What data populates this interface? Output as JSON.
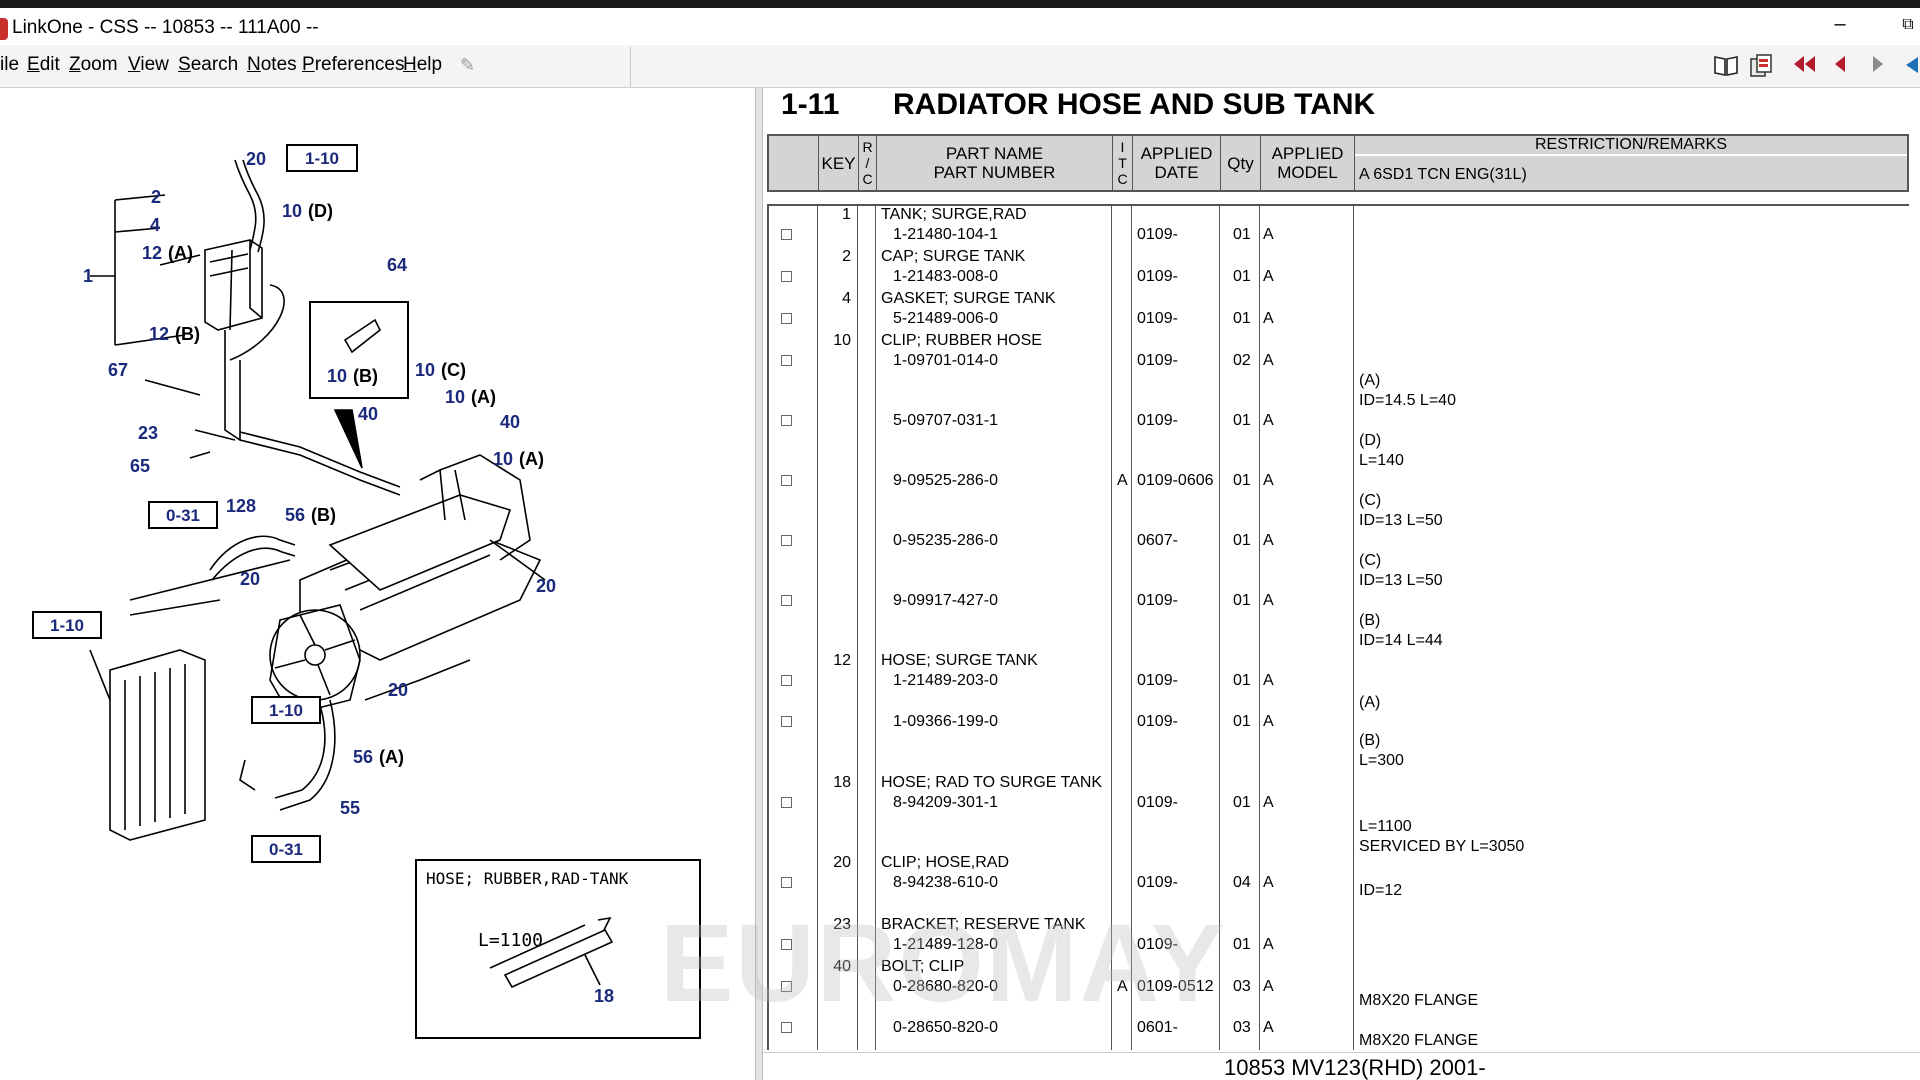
{
  "window": {
    "title": "LinkOne - CSS -- 10853 -- 111A00 --",
    "minimize": "–",
    "restore": "⧉"
  },
  "menu": [
    {
      "pre": "",
      "ul": "",
      "post": "ile"
    },
    {
      "pre": "",
      "ul": "E",
      "post": "dit"
    },
    {
      "pre": "",
      "ul": "Z",
      "post": "oom"
    },
    {
      "pre": "",
      "ul": "V",
      "post": "iew"
    },
    {
      "pre": "",
      "ul": "S",
      "post": "earch"
    },
    {
      "pre": "",
      "ul": "N",
      "post": "otes"
    },
    {
      "pre": "",
      "ul": "P",
      "post": "references"
    },
    {
      "pre": "",
      "ul": "H",
      "post": "elp"
    }
  ],
  "toolbar_icons": [
    "pin-icon",
    "book-icon",
    "notes-icon",
    "first-page-icon",
    "prev-page-icon",
    "next-page-icon",
    "back-icon"
  ],
  "section": {
    "number": "1-11",
    "title": "RADIATOR HOSE AND SUB TANK"
  },
  "columns": {
    "key": "KEY",
    "rc": [
      "R",
      "/",
      "C"
    ],
    "part_name": "PART NAME",
    "part_number": "PART NUMBER",
    "itc": [
      "I",
      "T",
      "C"
    ],
    "applied_date": [
      "APPLIED",
      "DATE"
    ],
    "qty": "Qty",
    "applied_model": [
      "APPLIED",
      "MODEL"
    ],
    "remarks": "RESTRICTION/REMARKS",
    "model_line": "A 6SD1 TCN ENG(31L)"
  },
  "rows": [
    {
      "key": "1",
      "name": "TANK; SURGE,RAD",
      "number": "1-21480-104-1",
      "itc": "",
      "date": "0109-",
      "qty": "01",
      "model": "A",
      "remarks": []
    },
    {
      "key": "2",
      "name": "CAP; SURGE TANK",
      "number": "1-21483-008-0",
      "itc": "",
      "date": "0109-",
      "qty": "01",
      "model": "A",
      "remarks": []
    },
    {
      "key": "4",
      "name": "GASKET; SURGE TANK",
      "number": "5-21489-006-0",
      "itc": "",
      "date": "0109-",
      "qty": "01",
      "model": "A",
      "remarks": []
    },
    {
      "key": "10",
      "name": "CLIP; RUBBER HOSE",
      "number": "1-09701-014-0",
      "itc": "",
      "date": "0109-",
      "qty": "02",
      "model": "A",
      "remarks": [
        "(A)",
        "ID=14.5 L=40"
      ]
    },
    {
      "key": "",
      "name": "",
      "number": "5-09707-031-1",
      "itc": "",
      "date": "0109-",
      "qty": "01",
      "model": "A",
      "remarks": [
        "(D)",
        "L=140"
      ]
    },
    {
      "key": "",
      "name": "",
      "number": "9-09525-286-0",
      "itc": "A",
      "date": "0109-0606",
      "qty": "01",
      "model": "A",
      "remarks": [
        "(C)",
        "ID=13 L=50"
      ]
    },
    {
      "key": "",
      "name": "",
      "number": "0-95235-286-0",
      "itc": "",
      "date": "0607-",
      "qty": "01",
      "model": "A",
      "remarks": [
        "(C)",
        "ID=13 L=50"
      ]
    },
    {
      "key": "",
      "name": "",
      "number": "9-09917-427-0",
      "itc": "",
      "date": "0109-",
      "qty": "01",
      "model": "A",
      "remarks": [
        "(B)",
        "ID=14 L=44"
      ]
    },
    {
      "key": "12",
      "name": "HOSE; SURGE TANK",
      "number": "1-21489-203-0",
      "itc": "",
      "date": "0109-",
      "qty": "01",
      "model": "A",
      "remarks": [
        "(A)"
      ]
    },
    {
      "key": "",
      "name": "",
      "number": "1-09366-199-0",
      "itc": "",
      "date": "0109-",
      "qty": "01",
      "model": "A",
      "remarks": [
        "(B)",
        "L=300"
      ]
    },
    {
      "key": "18",
      "name": "HOSE; RAD TO SURGE TANK",
      "number": "8-94209-301-1",
      "itc": "",
      "date": "0109-",
      "qty": "01",
      "model": "A",
      "remarks": [
        "L=1100",
        "SERVICED BY L=3050"
      ]
    },
    {
      "key": "20",
      "name": "CLIP; HOSE,RAD",
      "number": "8-94238-610-0",
      "itc": "",
      "date": "0109-",
      "qty": "04",
      "model": "A",
      "remarks": [
        "ID=12"
      ]
    },
    {
      "key": "23",
      "name": "BRACKET; RESERVE TANK",
      "number": "1-21489-128-0",
      "itc": "",
      "date": "0109-",
      "qty": "01",
      "model": "A",
      "remarks": []
    },
    {
      "key": "40",
      "name": "BOLT; CLIP",
      "number": "0-28680-820-0",
      "itc": "A",
      "date": "0109-0512",
      "qty": "03",
      "model": "A",
      "remarks": [
        "M8X20 FLANGE"
      ]
    },
    {
      "key": "",
      "name": "",
      "number": "0-28650-820-0",
      "itc": "",
      "date": "0601-",
      "qty": "03",
      "model": "A",
      "remarks": [
        "M8X20 FLANGE"
      ]
    }
  ],
  "diagram": {
    "callouts": [
      {
        "n": "20",
        "s": ""
      },
      {
        "n": "2",
        "s": ""
      },
      {
        "n": "4",
        "s": ""
      },
      {
        "n": "12",
        "s": "(A)"
      },
      {
        "n": "1",
        "s": ""
      },
      {
        "n": "10",
        "s": "(D)"
      },
      {
        "n": "64",
        "s": ""
      },
      {
        "n": "12",
        "s": "(B)"
      },
      {
        "n": "10",
        "s": "(B)"
      },
      {
        "n": "67",
        "s": ""
      },
      {
        "n": "10",
        "s": "(C)"
      },
      {
        "n": "10",
        "s": "(A)"
      },
      {
        "n": "40",
        "s": ""
      },
      {
        "n": "40",
        "s": ""
      },
      {
        "n": "23",
        "s": ""
      },
      {
        "n": "10",
        "s": "(A)"
      },
      {
        "n": "65",
        "s": ""
      },
      {
        "n": "128",
        "s": ""
      },
      {
        "n": "56",
        "s": "(B)"
      },
      {
        "n": "20",
        "s": ""
      },
      {
        "n": "20",
        "s": ""
      },
      {
        "n": "20",
        "s": ""
      },
      {
        "n": "56",
        "s": "(A)"
      },
      {
        "n": "55",
        "s": ""
      }
    ],
    "ref_boxes": [
      "1-10",
      "0-31",
      "1-10",
      "1-10",
      "0-31"
    ],
    "inset": {
      "title": "HOSE; RUBBER,RAD-TANK",
      "length": "L=1100",
      "callout": "18"
    }
  },
  "status": "10853 MV123(RHD) 2001-",
  "watermark": "EUROMAY"
}
